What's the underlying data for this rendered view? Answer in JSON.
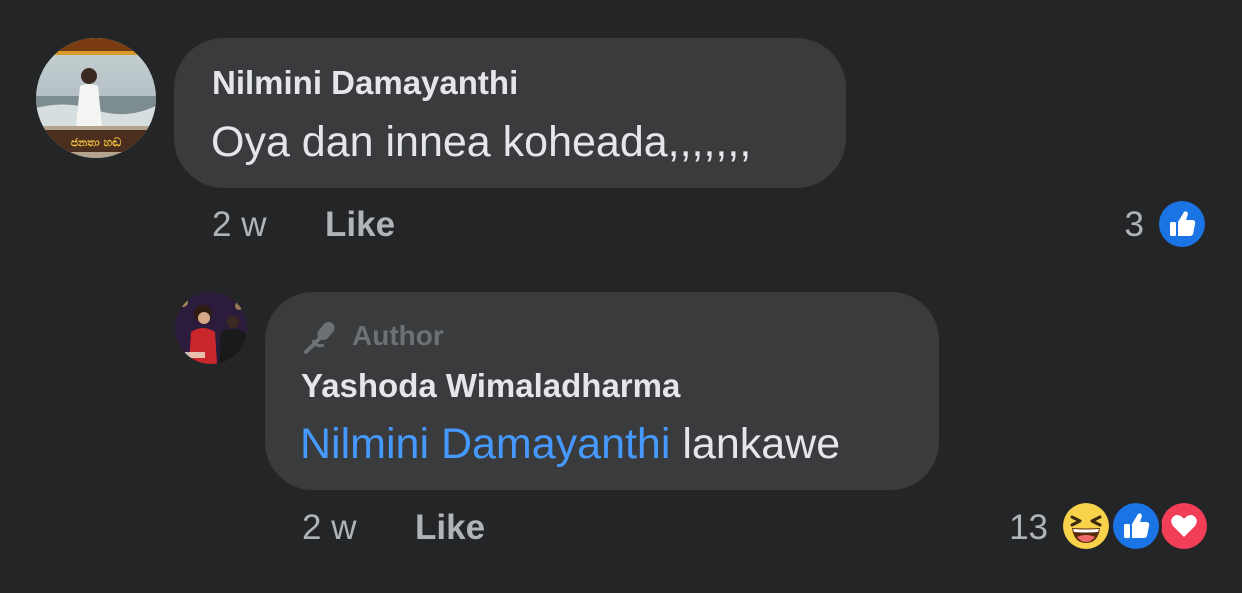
{
  "comment": {
    "author": "Nilmini Damayanthi",
    "text": "Oya dan innea koheada,,,,,,,",
    "time": "2 w",
    "like_label": "Like",
    "reaction_count": "3",
    "reactions": [
      "like-icon"
    ],
    "avatar_caption": "ජනතා හඬ"
  },
  "reply": {
    "badge": "Author",
    "author": "Yashoda Wimaladharma",
    "mention": "Nilmini Damayanthi",
    "text": " lankawe",
    "time": "2 w",
    "like_label": "Like",
    "reaction_count": "13",
    "reactions": [
      "haha-icon",
      "like-icon",
      "love-icon"
    ]
  },
  "colors": {
    "background": "#242526",
    "bubble": "#3a3b3c",
    "primary_text": "#e4e6eb",
    "secondary_text": "#b0b3b8",
    "link": "#4599ff",
    "like_blue": "#1b74e4",
    "love_red": "#f33e58",
    "haha_yellow": "#f7d24a"
  }
}
